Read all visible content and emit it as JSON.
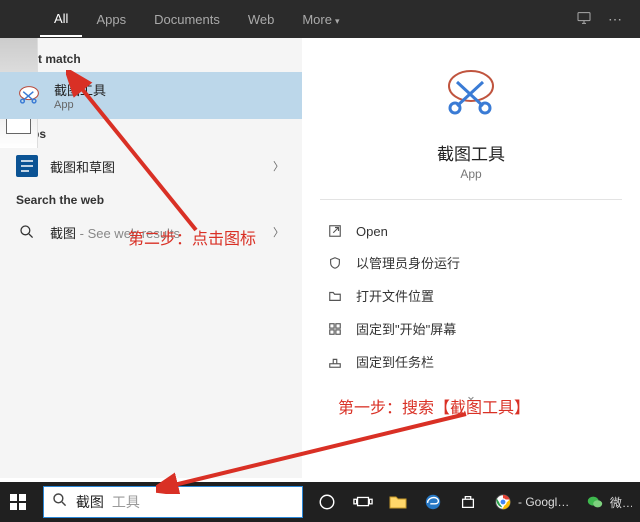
{
  "tabs": {
    "all": "All",
    "apps": "Apps",
    "documents": "Documents",
    "web": "Web",
    "more": "More"
  },
  "topActions": {
    "feedback": "⚐",
    "more": "⋯"
  },
  "left": {
    "bestMatch": "Best match",
    "topResult": {
      "title": "截图工具",
      "sub": "App"
    },
    "appsLabel": "Apps",
    "app1": {
      "title": "截图和草图"
    },
    "searchWebLabel": "Search the web",
    "web1": {
      "prefix": "截图",
      "suffix": " - See web results"
    }
  },
  "right": {
    "title": "截图工具",
    "sub": "App",
    "actions": {
      "open": "Open",
      "runAdmin": "以管理员身份运行",
      "fileLoc": "打开文件位置",
      "pinStart": "固定到\"开始\"屏幕",
      "pinTask": "固定到任务栏"
    }
  },
  "search": {
    "value": "截图",
    "rest": "工具",
    "combined": "截图工具"
  },
  "annotations": {
    "step1": "第一步：搜索【截图工具】",
    "step2": "第二步：点击图标"
  },
  "taskbar": {
    "chromeLabel": "- Google ...",
    "wechat": "微信"
  },
  "colors": {
    "accent": "#2b88d8",
    "annotation": "#d93025",
    "selected": "#bcd7ea"
  }
}
